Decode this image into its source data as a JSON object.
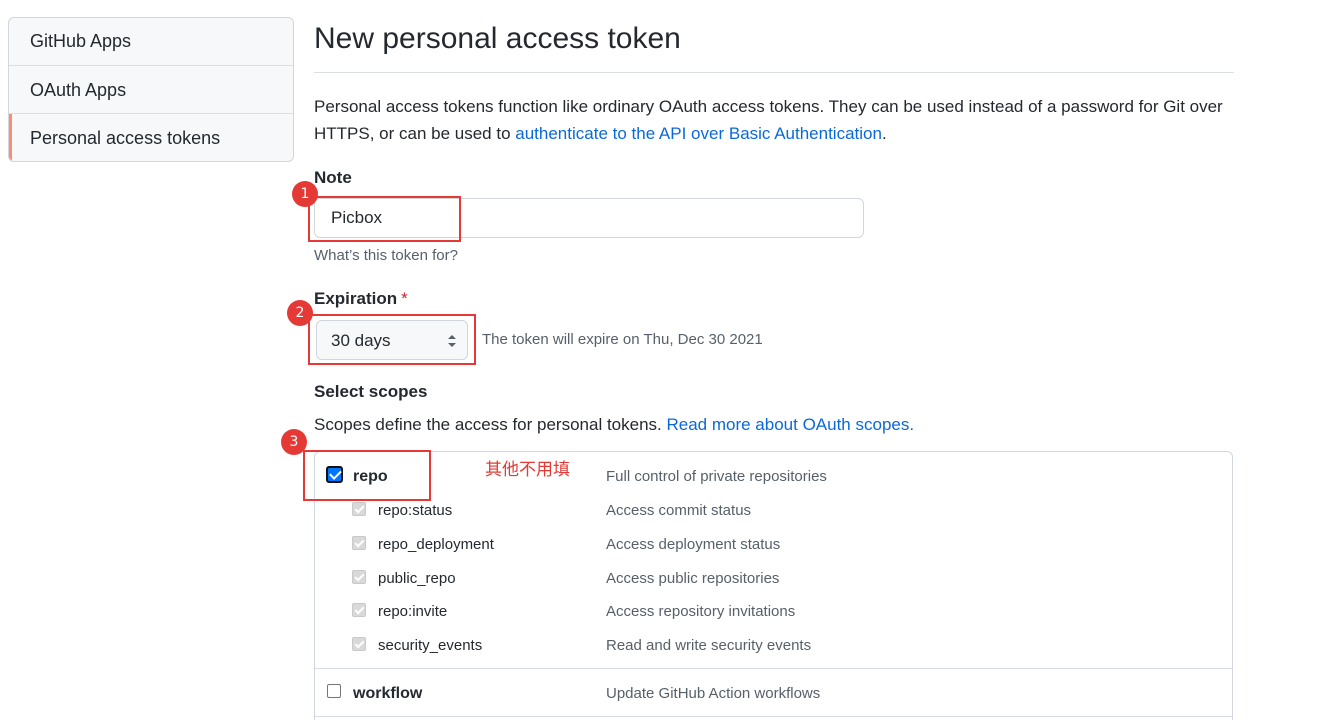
{
  "sidebar": {
    "items": [
      {
        "label": "GitHub Apps"
      },
      {
        "label": "OAuth Apps"
      },
      {
        "label": "Personal access tokens"
      }
    ]
  },
  "main": {
    "title": "New personal access token",
    "intro_text": "Personal access tokens function like ordinary OAuth access tokens. They can be used instead of a password for Git over HTTPS, or can be used to ",
    "intro_link": "authenticate to the API over Basic Authentication",
    "intro_end": ".",
    "note": {
      "label": "Note",
      "value": "Picbox",
      "hint": "What’s this token for?"
    },
    "expiration": {
      "label": "Expiration",
      "required_mark": "*",
      "selected": "30 days",
      "info": "The token will expire on Thu, Dec 30 2021"
    },
    "scopes": {
      "label": "Select scopes",
      "desc": "Scopes define the access for personal tokens. ",
      "desc_link": "Read more about OAuth scopes.",
      "items": [
        {
          "name": "repo",
          "desc": "Full control of private repositories",
          "checked": true
        },
        {
          "name": "repo:status",
          "desc": "Access commit status",
          "checked": true
        },
        {
          "name": "repo_deployment",
          "desc": "Access deployment status",
          "checked": true
        },
        {
          "name": "public_repo",
          "desc": "Access public repositories",
          "checked": true
        },
        {
          "name": "repo:invite",
          "desc": "Access repository invitations",
          "checked": true
        },
        {
          "name": "security_events",
          "desc": "Read and write security events",
          "checked": true
        },
        {
          "name": "workflow",
          "desc": "Update GitHub Action workflows",
          "checked": false
        }
      ]
    }
  },
  "annotations": {
    "badge1": "1",
    "badge2": "2",
    "badge3": "3",
    "note_text": "其他不用填",
    "color": "#e53935"
  }
}
